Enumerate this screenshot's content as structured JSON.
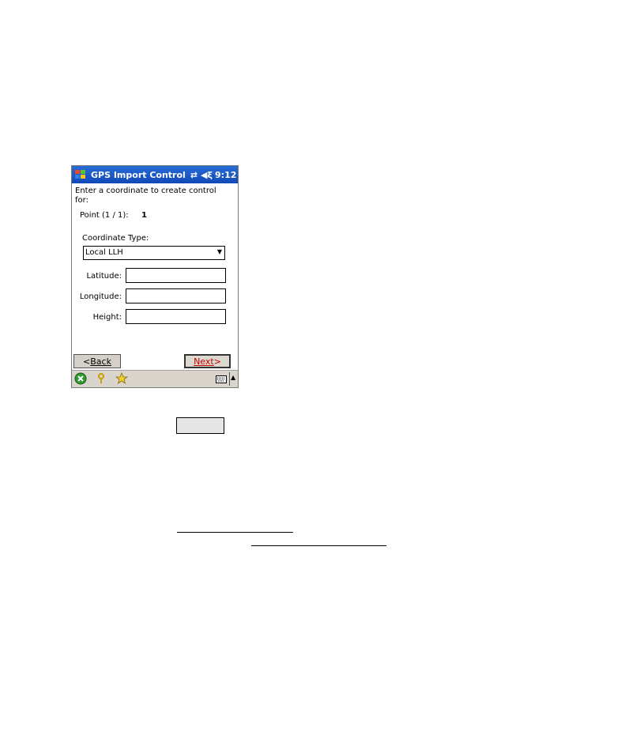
{
  "title_bar": {
    "title": "GPS Import Control",
    "time": "9:12",
    "icons": [
      "windows-start-icon",
      "connectivity-icon",
      "volume-icon"
    ]
  },
  "form": {
    "prompt": "Enter a coordinate to create control for:",
    "point_label": "Point (1 / 1):",
    "point_value": "1",
    "coordinate_type_label": "Coordinate Type:",
    "coordinate_type_value": "Local LLH",
    "latitude_label": "Latitude:",
    "latitude_value": "",
    "longitude_label": "Longitude:",
    "longitude_value": "",
    "height_label": "Height:",
    "height_value": ""
  },
  "buttons": {
    "back_prefix": "< ",
    "back_label": "Back",
    "next_label": "Next",
    "next_suffix": " >"
  },
  "taskbar": {
    "icons": [
      "close-icon",
      "help-icon",
      "favorites-icon",
      "keyboard-icon",
      "sip-arrow-icon"
    ]
  },
  "colors": {
    "title_bar": "#1a56c6",
    "next_text": "#c00000",
    "taskbar": "#d9d4cc"
  }
}
